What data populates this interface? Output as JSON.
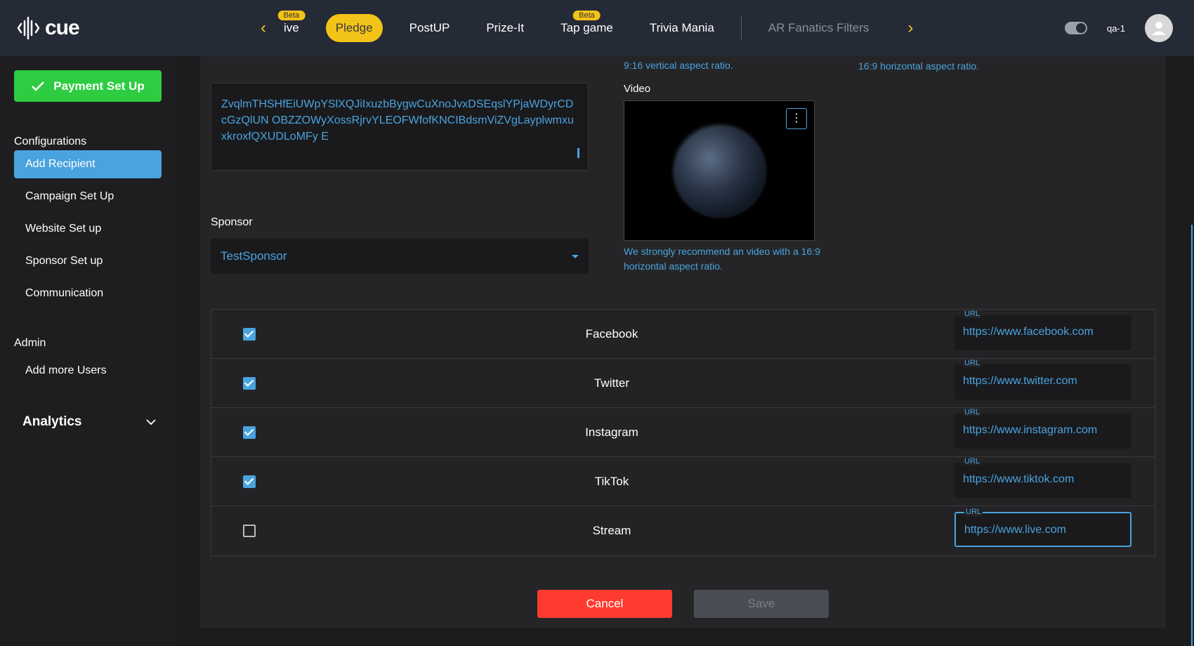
{
  "topbar": {
    "logo_text": "cue",
    "nav": [
      {
        "label": "ive",
        "beta": "Beta",
        "active": false,
        "muted": false
      },
      {
        "label": "Pledge",
        "beta": "",
        "active": true,
        "muted": false
      },
      {
        "label": "PostUP",
        "beta": "",
        "active": false,
        "muted": false
      },
      {
        "label": "Prize-It",
        "beta": "",
        "active": false,
        "muted": false
      },
      {
        "label": "Tap game",
        "beta": "Beta",
        "active": false,
        "muted": false
      },
      {
        "label": "Trivia Mania",
        "beta": "",
        "active": false,
        "muted": false
      },
      {
        "label": "AR Fanatics Filters",
        "beta": "",
        "active": false,
        "muted": true
      }
    ],
    "prev_arrow": "‹",
    "next_arrow": "›",
    "user_name": "qa-1"
  },
  "sidebar": {
    "payment_button": "Payment Set Up",
    "configurations_label": "Configurations",
    "config_items": [
      "Add Recipient",
      "Campaign Set Up",
      "Website Set up",
      "Sponsor Set up",
      "Communication"
    ],
    "admin_label": "Admin",
    "admin_items": [
      "Add more Users"
    ],
    "analytics_label": "Analytics"
  },
  "main": {
    "description_text": "ZvqlmTHSHfEiUWpYSlXQJiIxuzbBygwCuXnoJvxDSEqslYPjaWDyrCDcGzQlUN OBZZOWyXossRjrvYLEOFWfofKNCIBdsmViZVgLayplwmxuxkroxfQXUDLoMFy E",
    "note_vertical": "9:16 vertical aspect ratio.",
    "note_horizontal_top": "16:9 horizontal aspect ratio.",
    "video_label": "Video",
    "video_note": "We strongly recommend an video with a 16:9 horizontal aspect ratio.",
    "sponsor_label": "Sponsor",
    "sponsor_value": "TestSponsor",
    "url_label": "URL",
    "socials": [
      {
        "name": "Facebook",
        "checked": true,
        "url": "https://www.facebook.com"
      },
      {
        "name": "Twitter",
        "checked": true,
        "url": "https://www.twitter.com"
      },
      {
        "name": "Instagram",
        "checked": true,
        "url": "https://www.instagram.com"
      },
      {
        "name": "TikTok",
        "checked": true,
        "url": "https://www.tiktok.com"
      },
      {
        "name": "Stream",
        "checked": false,
        "url": "https://www.live.com"
      }
    ],
    "cancel_label": "Cancel",
    "save_label": "Save"
  },
  "colors": {
    "accent": "#4aa3df",
    "brand_yellow": "#f2c318",
    "success": "#2ecc40",
    "danger": "#ff3b30"
  }
}
